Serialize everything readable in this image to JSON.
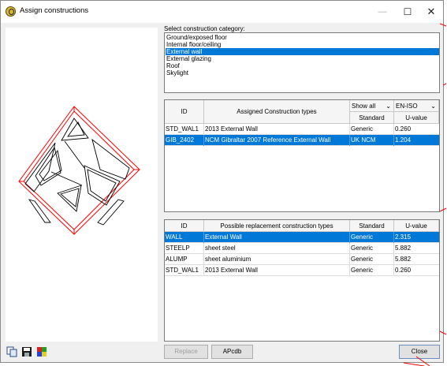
{
  "window": {
    "title": "Assign constructions"
  },
  "category": {
    "label": "Select construction category:",
    "items": [
      "Ground/exposed floor",
      "Internal floor/ceiling",
      "External wall",
      "External glazing",
      "Roof",
      "Skylight"
    ],
    "selected_index": 2
  },
  "assigned": {
    "headers": {
      "id": "ID",
      "name": "Assigned Construction types",
      "filter": "Show all",
      "norm": "EN-ISO",
      "standard": "Standard",
      "uvalue": "U-value"
    },
    "rows": [
      {
        "id": "STD_WAL1",
        "name": "2013 External Wall",
        "standard": "Generic",
        "uvalue": "0.260"
      },
      {
        "id": "GIB_2402",
        "name": "NCM Gibraltar 2007 Reference External Wall",
        "standard": "UK NCM",
        "uvalue": "1.204"
      }
    ],
    "selected_index": 1
  },
  "replacement": {
    "headers": {
      "id": "ID",
      "name": "Possible replacement construction types",
      "standard": "Standard",
      "uvalue": "U-value"
    },
    "rows": [
      {
        "id": "WALL",
        "name": "External Wall",
        "standard": "Generic",
        "uvalue": "2.315"
      },
      {
        "id": "STEELP",
        "name": "sheet steel",
        "standard": "Generic",
        "uvalue": "5.882"
      },
      {
        "id": "ALUMP",
        "name": "sheet aluminium",
        "standard": "Generic",
        "uvalue": "5.882"
      },
      {
        "id": "STD_WAL1",
        "name": "2013 External Wall",
        "standard": "Generic",
        "uvalue": "0.260"
      }
    ],
    "selected_index": 0
  },
  "buttons": {
    "replace": "Replace",
    "apcdb": "APcdb",
    "close": "Close"
  },
  "colors": {
    "selection": "#0078d7",
    "model_edges": "#ff0000"
  },
  "icons": {
    "minimize": "window-minimize-icon",
    "maximize": "window-maximize-icon",
    "close": "window-close-icon",
    "copy": "copy-icon",
    "save": "save-icon",
    "palette": "palette-icon"
  }
}
